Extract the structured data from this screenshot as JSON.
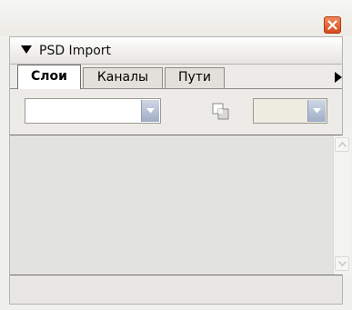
{
  "panel": {
    "title": "PSD Import"
  },
  "tabs": [
    {
      "label": "Слои",
      "active": true
    },
    {
      "label": "Каналы",
      "active": false
    },
    {
      "label": "Пути",
      "active": false
    }
  ],
  "toolbar": {
    "blend_mode": {
      "value": ""
    },
    "opacity": {
      "value": ""
    }
  },
  "icons": {
    "close": "close-icon",
    "collapse": "triangle-down-icon",
    "tab_scroll": "arrow-right-icon",
    "swatch": "color-swatch-icon",
    "dropdown": "chevron-down-icon"
  },
  "colors": {
    "close_button": "#e0592a",
    "dropdown_button": "#b4bfd4",
    "list_background": "#e2e2de"
  }
}
